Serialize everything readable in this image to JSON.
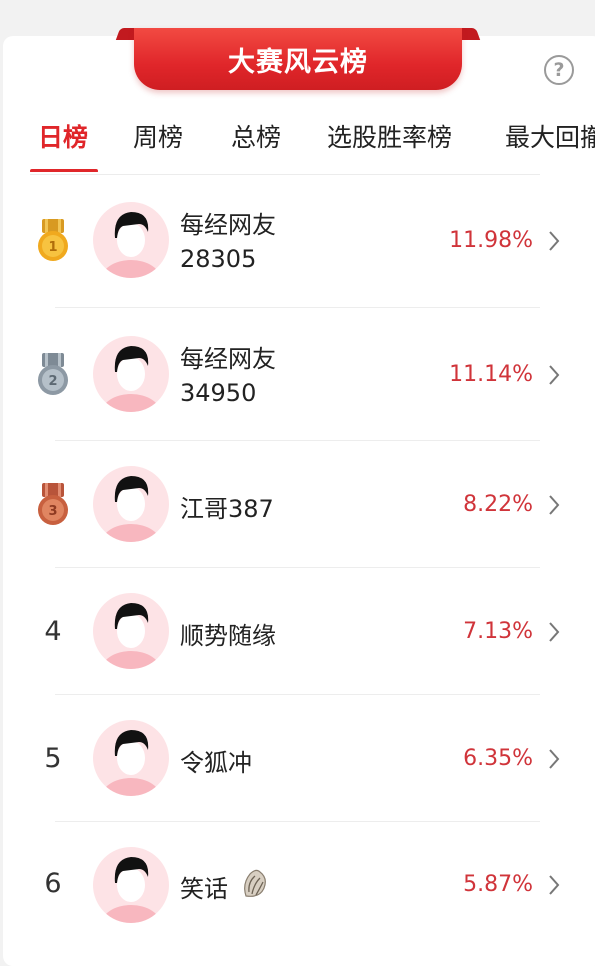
{
  "banner": {
    "title": "大赛风云榜"
  },
  "help_icon": "?",
  "tabs": [
    {
      "label": "日榜",
      "active": true
    },
    {
      "label": "周榜",
      "active": false
    },
    {
      "label": "总榜",
      "active": false
    },
    {
      "label": "选股胜率榜",
      "active": false
    },
    {
      "label": "最大回撤",
      "active": false
    }
  ],
  "colors": {
    "accent": "#e0262a",
    "percent": "#d0343a",
    "avatar_bg": "#fde3e6"
  },
  "rankings": [
    {
      "rank": "1",
      "medal": "gold",
      "name_line1": "每经网友",
      "name_line2": "28305",
      "percent": "11.98%"
    },
    {
      "rank": "2",
      "medal": "silver",
      "name_line1": "每经网友",
      "name_line2": "34950",
      "percent": "11.14%"
    },
    {
      "rank": "3",
      "medal": "bronze",
      "name_line1": "江哥387",
      "name_line2": "",
      "percent": "8.22%"
    },
    {
      "rank": "4",
      "medal": "",
      "name_line1": "顺势随缘",
      "name_line2": "",
      "percent": "7.13%"
    },
    {
      "rank": "5",
      "medal": "",
      "name_line1": "令狐冲",
      "name_line2": "",
      "percent": "6.35%"
    },
    {
      "rank": "6",
      "medal": "",
      "name_line1": "笑话",
      "name_line2": "",
      "name_icon": "conch-shell-icon",
      "percent": "5.87%"
    }
  ]
}
